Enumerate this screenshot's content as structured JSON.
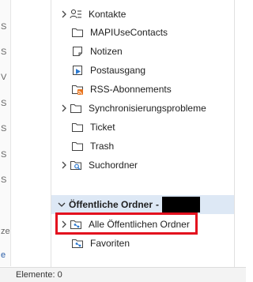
{
  "folders": [
    {
      "label": "Kontakte",
      "icon": "contacts-icon",
      "expandable": true
    },
    {
      "label": "MAPIUseContacts",
      "icon": "folder-icon",
      "expandable": false
    },
    {
      "label": "Notizen",
      "icon": "notes-icon",
      "expandable": false
    },
    {
      "label": "Postausgang",
      "icon": "outbox-icon",
      "expandable": false
    },
    {
      "label": "RSS-Abonnements",
      "icon": "rss-icon",
      "expandable": false
    },
    {
      "label": "Synchronisierungsprobleme",
      "icon": "folder-icon",
      "expandable": true
    },
    {
      "label": "Ticket",
      "icon": "folder-icon",
      "expandable": false
    },
    {
      "label": "Trash",
      "icon": "folder-icon",
      "expandable": false
    },
    {
      "label": "Suchordner",
      "icon": "search-folder-icon",
      "expandable": true
    }
  ],
  "public_section": {
    "title": "Öffentliche Ordner",
    "dash": "-",
    "items": [
      {
        "label": "Alle Öffentlichen Ordner",
        "icon": "public-folder-icon",
        "expandable": true,
        "highlighted": true
      },
      {
        "label": "Favoriten",
        "icon": "public-folder-icon",
        "expandable": false
      }
    ]
  },
  "status_bar": {
    "items_text": "Elemente: 0"
  },
  "colors": {
    "highlight": "#e3101e",
    "section_bg": "#dde8f5",
    "accent_blue": "#2b79d0"
  }
}
